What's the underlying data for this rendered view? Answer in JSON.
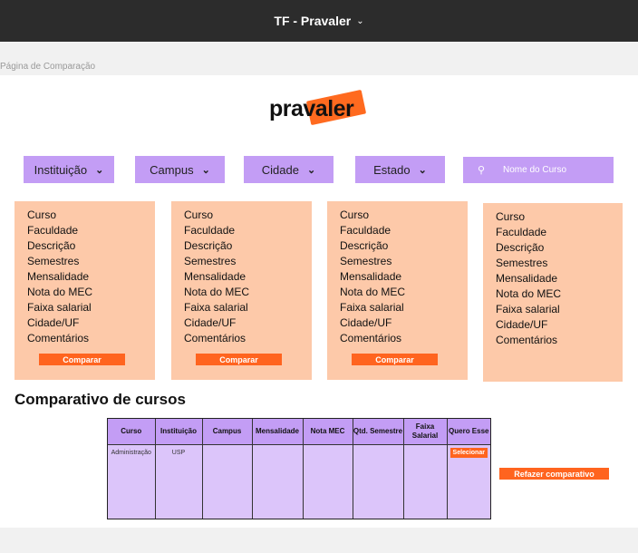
{
  "app": {
    "title": "TF - Pravaler",
    "frame_label": "Página de Comparação"
  },
  "logo": {
    "text": "pravaler"
  },
  "filters": [
    {
      "label": "Instituição"
    },
    {
      "label": "Campus"
    },
    {
      "label": "Cidade"
    },
    {
      "label": "Estado"
    }
  ],
  "search": {
    "placeholder": "Nome do Curso"
  },
  "card_fields": [
    "Curso",
    "Faculdade",
    "Descrição",
    "Semestres",
    "Mensalidade",
    "Nota do MEC",
    "Faixa salarial",
    "Cidade/UF",
    "Comentários"
  ],
  "compare_label": "Comparar",
  "comparison": {
    "title": "Comparativo de cursos",
    "headers": [
      "Curso",
      "Instituição",
      "Campus",
      "Mensalidade",
      "Nota MEC",
      "Qtd. Semestre",
      "Faixa Salarial",
      "Quero Esse"
    ],
    "rows": [
      {
        "curso": "Administração",
        "instituicao": "USP",
        "campus": "",
        "mensalidade": "",
        "nota_mec": "",
        "qtd_semestre": "",
        "faixa_salarial": "",
        "action": "Selecionar"
      }
    ],
    "redo_label": "Refazer comparativo"
  },
  "colors": {
    "topbar": "#2c2c2c",
    "purple": "#c39df5",
    "peach": "#fdc9a9",
    "orange": "#ff641f"
  }
}
